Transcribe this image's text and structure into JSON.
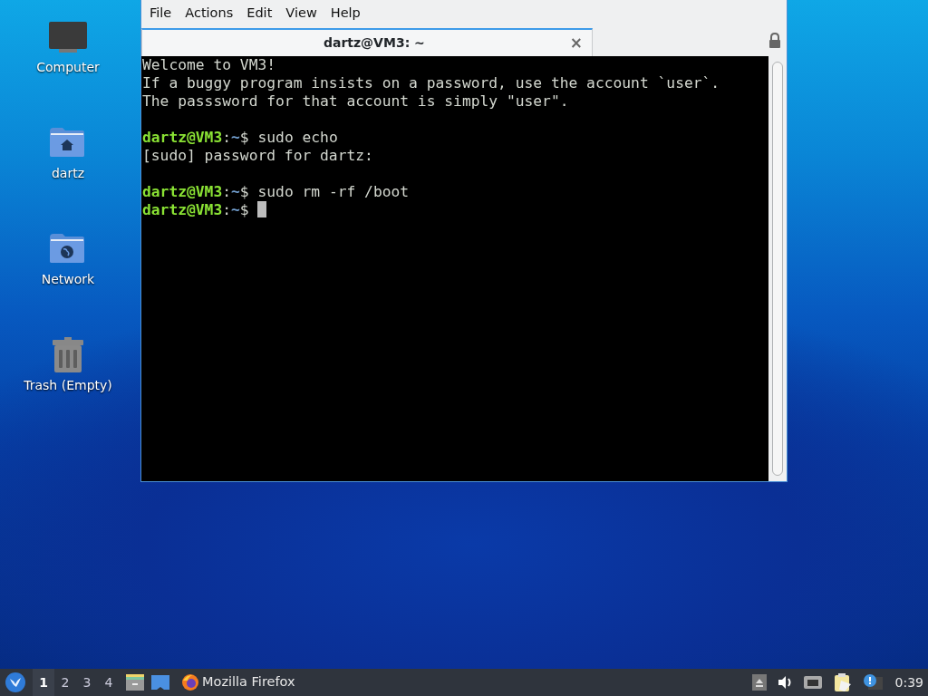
{
  "desktop_icons": [
    {
      "kind": "computer",
      "label": "Computer"
    },
    {
      "kind": "home",
      "label": "dartz"
    },
    {
      "kind": "network",
      "label": "Network"
    },
    {
      "kind": "trash",
      "label": "Trash (Empty)"
    }
  ],
  "window": {
    "menu": [
      "File",
      "Actions",
      "Edit",
      "View",
      "Help"
    ],
    "tabs": [
      {
        "label": "dartz@VM3: ~",
        "selected": true,
        "close": "×"
      }
    ],
    "terminal": [
      {
        "kind": "text",
        "text": "Welcome to VM3!"
      },
      {
        "kind": "text",
        "text": "If a buggy program insists on a password, use the account `user`."
      },
      {
        "kind": "text",
        "text": "The passsword for that account is simply \"user\"."
      },
      {
        "kind": "blank"
      },
      {
        "kind": "prompt",
        "user": "dartz@VM3",
        "sep": ":",
        "path": "~",
        "sigil": "$",
        "command": "sudo echo"
      },
      {
        "kind": "text",
        "text": "[sudo] password for dartz:"
      },
      {
        "kind": "blank"
      },
      {
        "kind": "prompt",
        "user": "dartz@VM3",
        "sep": ":",
        "path": "~",
        "sigil": "$",
        "command": "sudo rm -rf /boot"
      },
      {
        "kind": "prompt",
        "user": "dartz@VM3",
        "sep": ":",
        "path": "~",
        "sigil": "$",
        "cursor": true
      }
    ]
  },
  "taskbar": {
    "workspaces": [
      {
        "label": "1",
        "selected": true
      },
      {
        "label": "2",
        "selected": false
      },
      {
        "label": "3",
        "selected": false
      },
      {
        "label": "4",
        "selected": false
      }
    ],
    "tasks": [
      {
        "label": "Mozilla Firefox"
      }
    ],
    "clock": "0:39"
  }
}
